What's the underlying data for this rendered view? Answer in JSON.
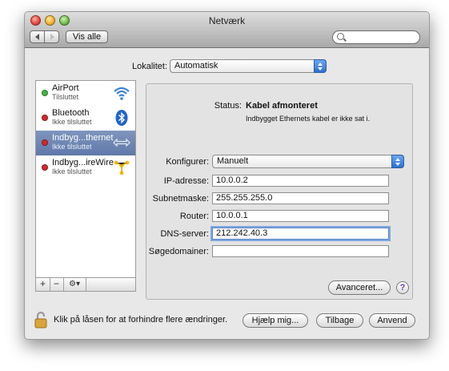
{
  "window": {
    "title": "Netværk"
  },
  "toolbar": {
    "show_all_label": "Vis alle",
    "search_placeholder": ""
  },
  "location": {
    "label": "Lokalitet:",
    "value": "Automatisk"
  },
  "services": [
    {
      "name": "AirPort",
      "status": "Tilsluttet",
      "dot_color": "#3fb93f",
      "icon": "wifi-icon",
      "selected": false
    },
    {
      "name": "Bluetooth",
      "status": "Ikke tilsluttet",
      "dot_color": "#d42a2a",
      "icon": "bluetooth-icon",
      "selected": false
    },
    {
      "name": "Indbyg...thernet",
      "status": "Ikke tilsluttet",
      "dot_color": "#d42a2a",
      "icon": "ethernet-icon",
      "selected": true
    },
    {
      "name": "Indbyg...ireWire",
      "status": "Ikke tilsluttet",
      "dot_color": "#d42a2a",
      "icon": "firewire-icon",
      "selected": false
    }
  ],
  "list_controls": {
    "add": "+",
    "remove": "−",
    "gear": "⚙▾"
  },
  "status": {
    "label": "Status:",
    "value": "Kabel afmonteret",
    "detail": "Indbygget Ethernets kabel er ikke sat i."
  },
  "configure": {
    "label": "Konfigurer:",
    "value": "Manuelt"
  },
  "fields": {
    "ip": {
      "label": "IP-adresse:",
      "value": "10.0.0.2"
    },
    "subnet": {
      "label": "Subnetmaske:",
      "value": "255.255.255.0"
    },
    "router": {
      "label": "Router:",
      "value": "10.0.0.1"
    },
    "dns": {
      "label": "DNS-server:",
      "value": "212.242.40.3"
    },
    "search_domains": {
      "label": "Søgedomainer:",
      "value": ""
    }
  },
  "buttons": {
    "advanced": "Avanceret...",
    "help_q": "?",
    "assist": "Hjælp mig...",
    "revert": "Tilbage",
    "apply": "Anvend"
  },
  "lock": {
    "text": "Klik på låsen for at forhindre flere ændringer."
  }
}
